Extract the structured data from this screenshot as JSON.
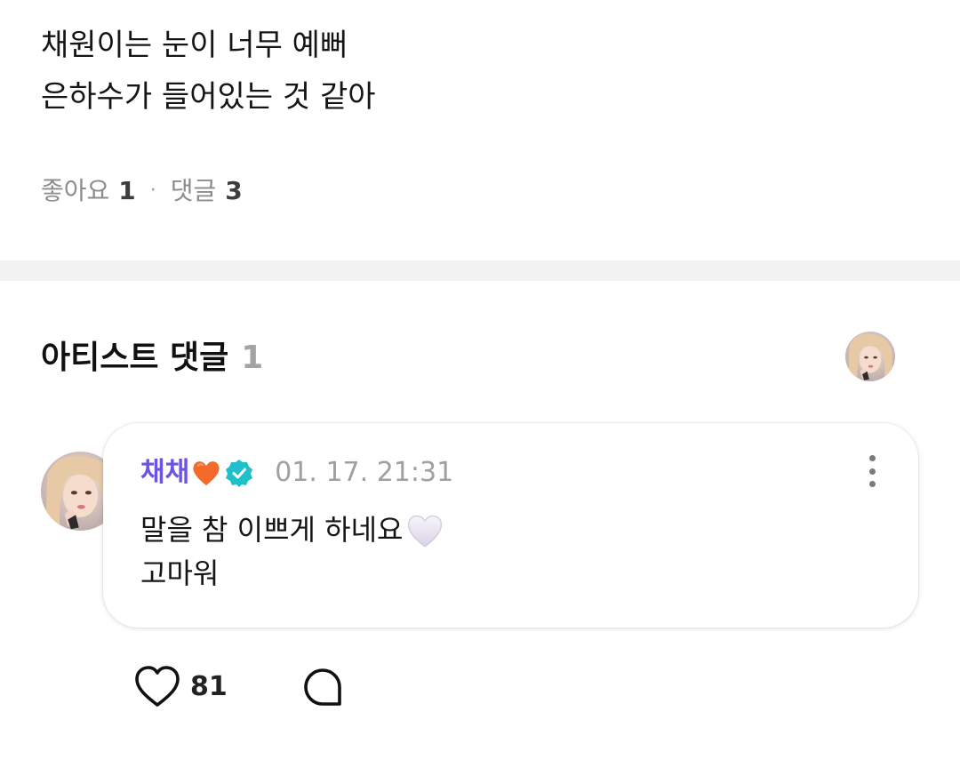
{
  "post": {
    "lines": [
      "채원이는 눈이 너무 예뻐",
      "은하수가 들어있는 것 같아"
    ],
    "likes_label": "좋아요",
    "likes_count": "1",
    "separator": "·",
    "comments_label": "댓글",
    "comments_count": "3"
  },
  "artist_comments": {
    "title": "아티스트 댓글",
    "count": "1",
    "header_avatar_icon": "artist-avatar-icon"
  },
  "comment": {
    "author": "채채",
    "author_emoji": "orange-heart-icon",
    "verified_icon": "verified-badge-icon",
    "timestamp": "01. 17. 21:31",
    "lines": [
      "말을 참 이쁘게 하네요",
      "고마워"
    ],
    "line_emoji": "white-heart-icon",
    "more_icon": "more-vertical-icon",
    "like_icon": "heart-outline-icon",
    "like_count": "81",
    "reply_icon": "comment-bubble-icon"
  },
  "colors": {
    "author_name": "#6a54e6",
    "verified_badge": "#1fc0c9",
    "orange_heart": "#f26b2a",
    "divider": "#f2f2f2",
    "muted_text": "#8c8c8c"
  }
}
